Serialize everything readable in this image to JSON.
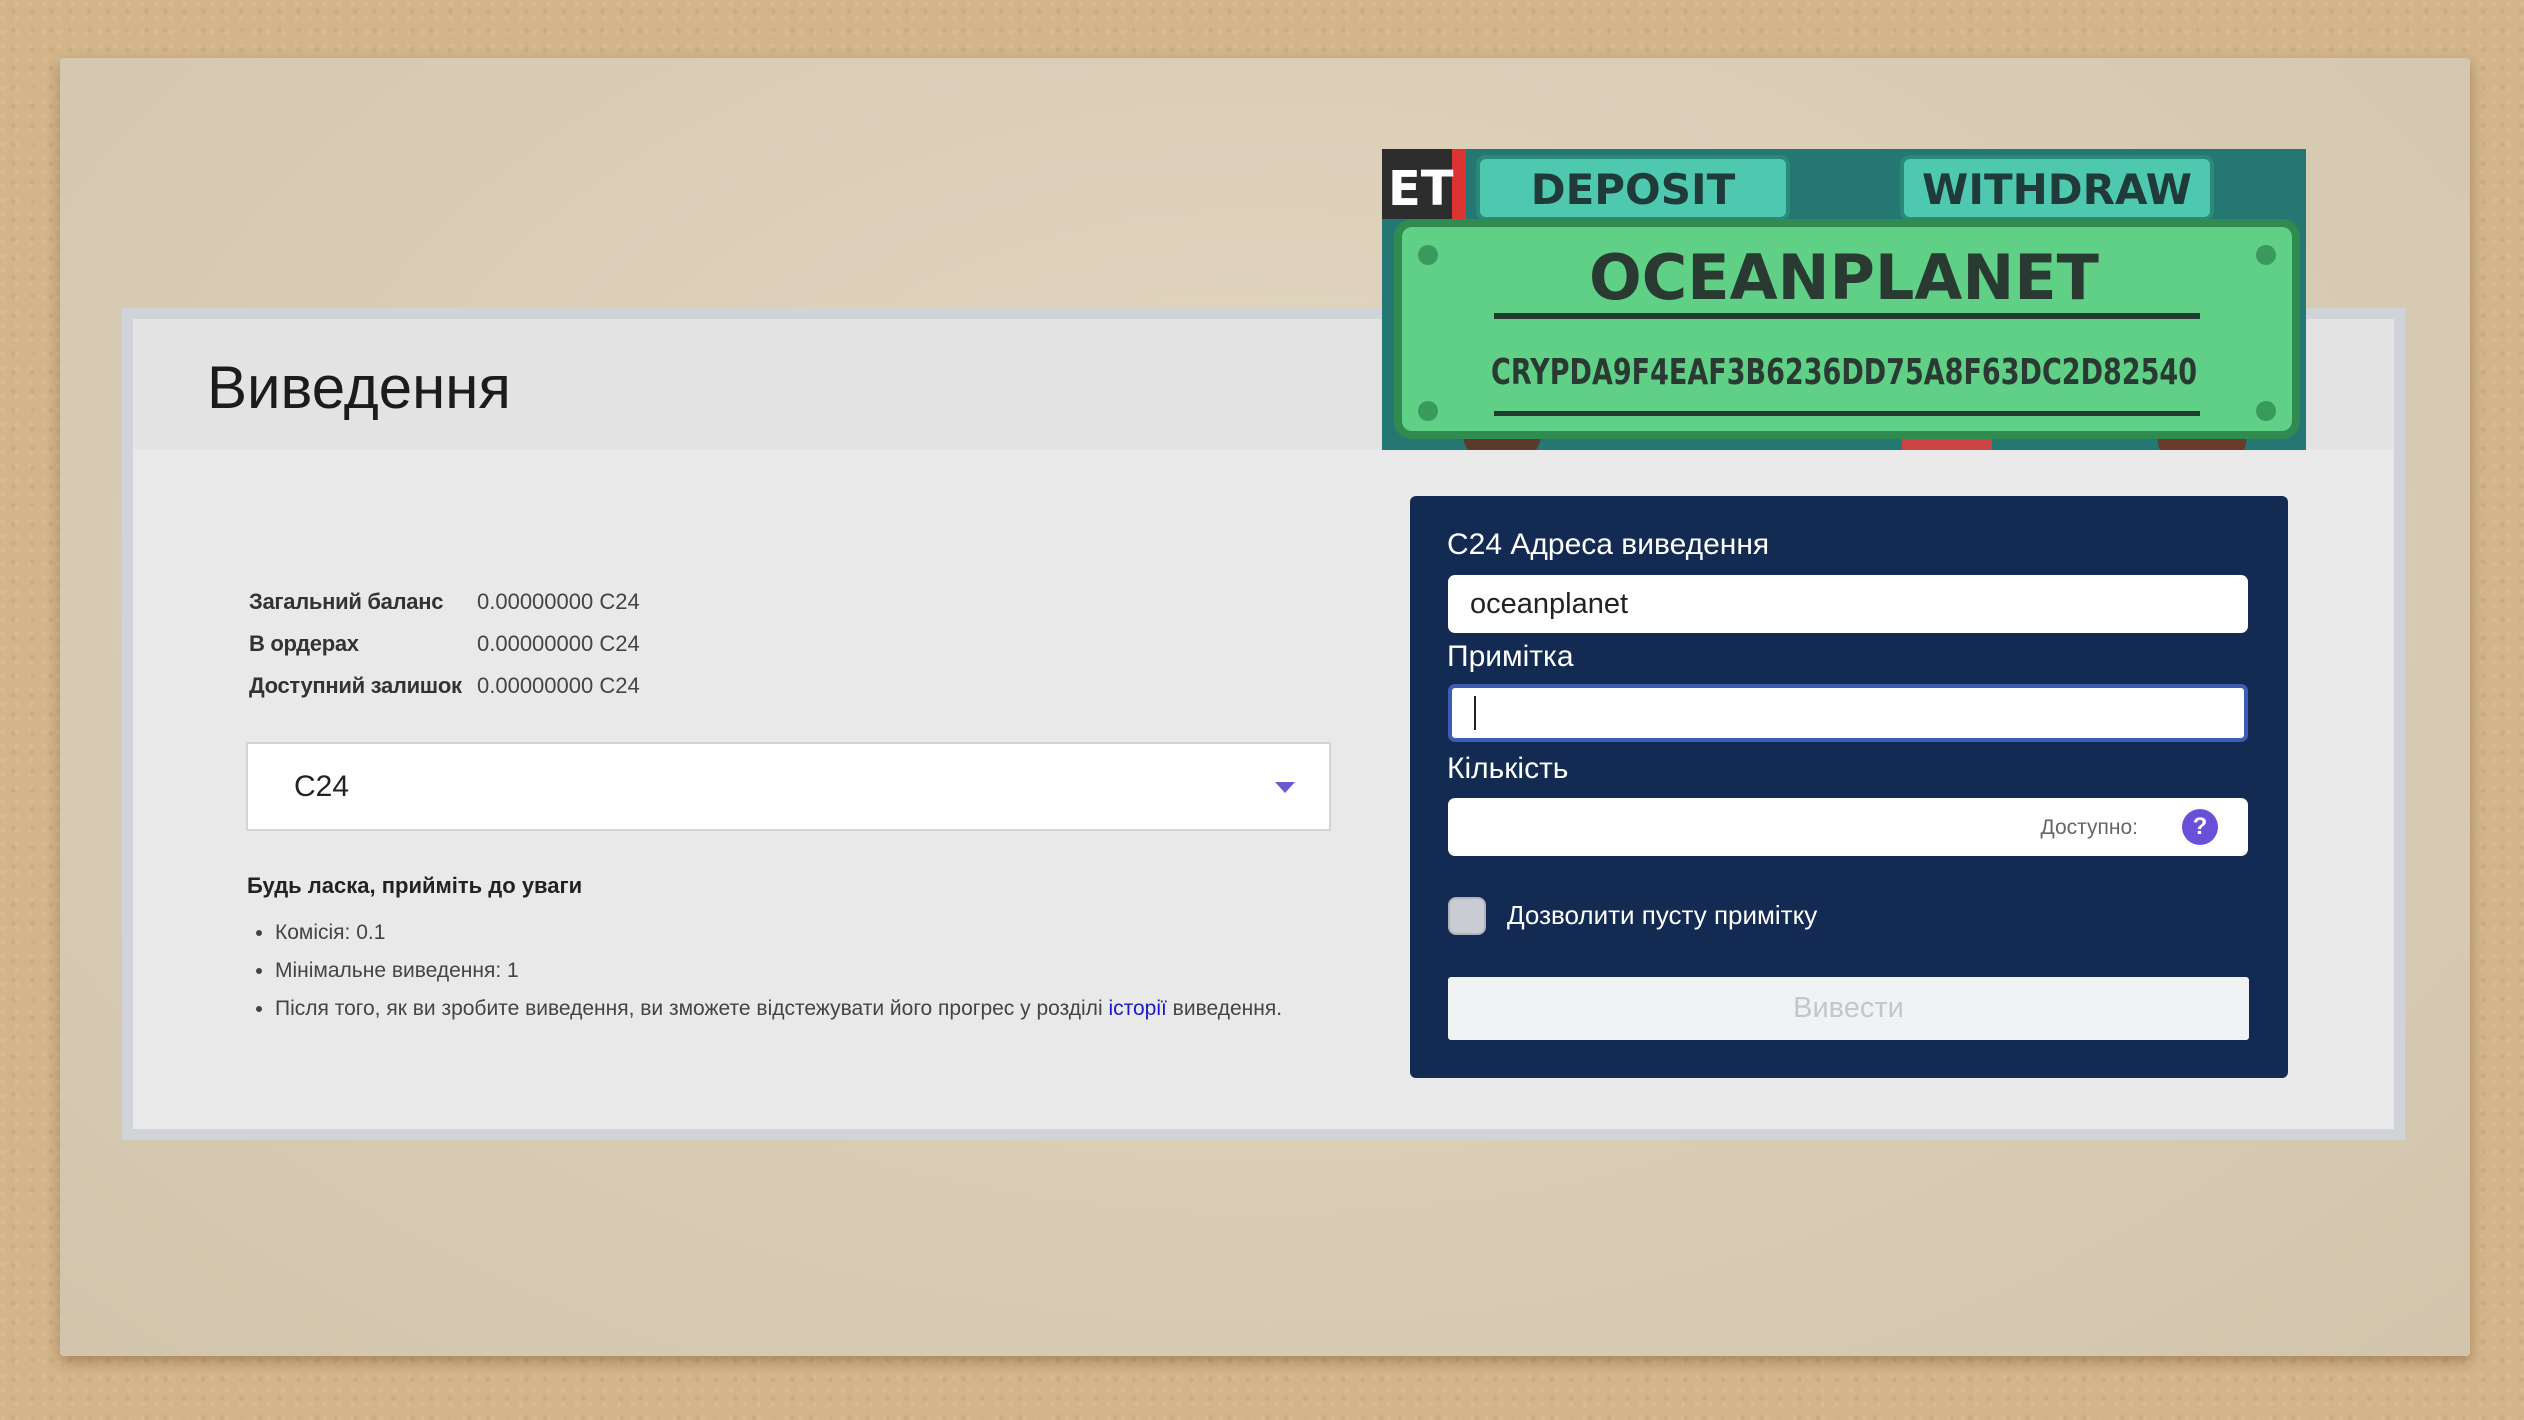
{
  "page": {
    "title": "Виведення"
  },
  "balances": [
    {
      "label": "Загальний баланс",
      "value": "0.00000000 C24"
    },
    {
      "label": "В ордерах",
      "value": "0.00000000 C24"
    },
    {
      "label": "Доступний залишок",
      "value": "0.00000000 C24"
    }
  ],
  "currency_select": {
    "selected": "C24"
  },
  "notice": {
    "title": "Будь ласка, прийміть до уваги",
    "fee": "Комісія: 0.1",
    "min_withdrawal": "Мінімальне виведення: 1",
    "history_before": "Після того, як ви зробите виведення, ви зможете відстежувати його прогрес у розділі ",
    "history_link": "історії",
    "history_after": " виведення."
  },
  "banner": {
    "corner_text": "ET",
    "deposit": "DEPOSIT",
    "withdraw": "WITHDRAW",
    "name": "OCEANPLANET",
    "code": "CRYPDA9F4EAF3B6236DD75A8F63DC2D82540"
  },
  "form": {
    "address_label": "C24 Адреса виведення",
    "address_value": "oceanplanet",
    "note_label": "Примітка",
    "note_value": "",
    "amount_label": "Кількість",
    "available_label": "Доступно:",
    "help_glyph": "?",
    "allow_empty_note_label": "Дозволити пусту примітку",
    "allow_empty_note_checked": false,
    "submit_label": "Вивести"
  },
  "colors": {
    "panel": "#132a52",
    "accent": "#6a4fd8",
    "link": "#1a1acc"
  }
}
